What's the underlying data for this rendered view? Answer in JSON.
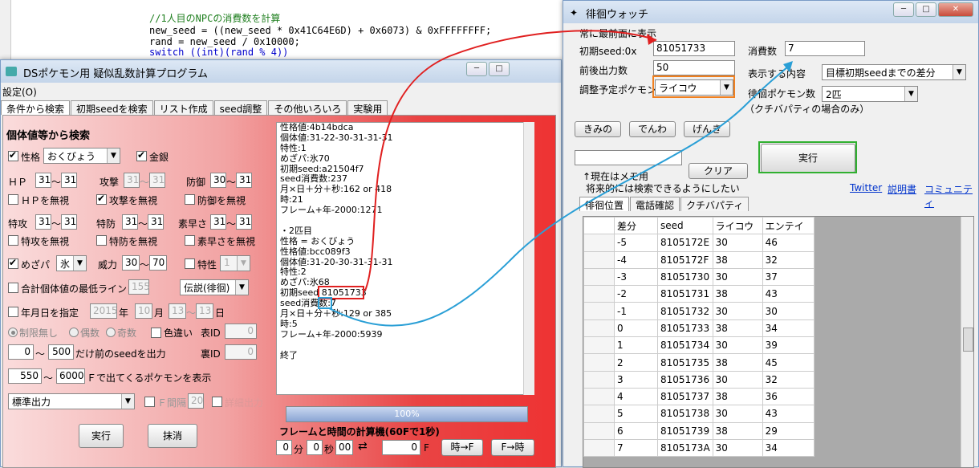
{
  "code": {
    "lines": [
      "//1人目のNPCの消費数を計算",
      "new_seed = ((new_seed * 0x41C64E6D) + 0x6073) & 0xFFFFFFFF;",
      "rand = new_seed / 0x10000;",
      "switch ((int)(rand % 4))"
    ]
  },
  "left_window": {
    "title": "DSポケモン用 疑似乱数計算プログラム",
    "menu": "設定(O)",
    "tabs": [
      "条件から検索",
      "初期seedを検索",
      "リスト作成",
      "seed調整",
      "その他いろいろ",
      "実験用"
    ],
    "section_title": "個体値等から検索",
    "nature_label": "性格",
    "nature_value": "おくびょう",
    "shiny_label": "金銀",
    "hp_label": "ＨＰ",
    "hp_min": "31",
    "hp_max": "31",
    "atk_label": "攻撃",
    "atk_min": "31",
    "atk_max": "31",
    "def_label": "防御",
    "def_min": "30",
    "def_max": "31",
    "ignore_hp": "ＨＰを無視",
    "ignore_atk": "攻撃を無視",
    "ignore_def": "防御を無視",
    "spa_label": "特攻",
    "spa_min": "31",
    "spa_max": "31",
    "spd_label": "特防",
    "spd_min": "31",
    "spd_max": "31",
    "spe_label": "素早さ",
    "spe_min": "31",
    "spe_max": "31",
    "ignore_spa": "特攻を無視",
    "ignore_spd": "特防を無視",
    "ignore_spe": "素早さを無視",
    "hp_type_label": "めざパ",
    "hp_type_value": "氷",
    "power_label": "威力",
    "power_min": "30",
    "power_max": "70",
    "ability_label": "特性",
    "ability_value": "1",
    "min_total_label": "合計個体値の最低ライン",
    "min_total_value": "155",
    "encounter_value": "伝説(徘徊)",
    "date_label": "年月日を指定",
    "year_value": "2015",
    "year_unit": "年",
    "month_value": "10",
    "month_unit": "月",
    "day_min": "13",
    "day_max": "13",
    "day_unit": "日",
    "radio_none": "制限無し",
    "radio_even": "偶数",
    "radio_odd": "奇数",
    "shiny_check": "色違い",
    "tid_label": "表ID",
    "tid_value": "0",
    "sid_label": "裏ID",
    "sid_value": "0",
    "seed_range_min": "0",
    "seed_range_max": "500",
    "seed_range_text": "だけ前のseedを出力",
    "frame_min": "550",
    "frame_max": "6000",
    "frame_text": "Ｆで出てくるポケモンを表示",
    "output_mode": "標準出力",
    "f_interval_label": "Ｆ間隔",
    "f_interval_value": "20",
    "extra_check": "詳細出力",
    "execute_button": "実行",
    "clear_button": "抹消",
    "result_lines": [
      "性格値:4b14bdca",
      "個体値:31-22-30-31-31-31",
      "特性:1",
      "めざパ:氷70",
      "初期seed:a21504f7",
      "seed消費数:237",
      "月×日＋分＋秒:162 or 418",
      "時:21",
      "フレーム+年-2000:1271",
      "",
      "・2匹目",
      "性格 = おくびょう",
      "性格値:bcc089f3",
      "個体値:31-20-30-31-31-31",
      "特性:2",
      "めざパ:氷68",
      "初期seed 81051733",
      "seed消費数:7",
      "月×日＋分＋秒:129 or 385",
      "時:5",
      "フレーム+年-2000:5939",
      "",
      "終了"
    ],
    "progress_text": "100%",
    "calc_title": "フレームと時間の計算機(60Fで1秒)",
    "minute_value": "0",
    "minute_unit": "分",
    "second_value": "0",
    "second_unit": "秒",
    "frame_value2": "00",
    "frame_result": "0",
    "frame_unit": "F",
    "time_to_f_button": "時→F",
    "f_to_time_button": "F→時"
  },
  "right_window": {
    "title": "徘徊ウォッチ",
    "topmost_label": "常に最前面に表示",
    "seed_label": "初期seed:0x",
    "seed_value": "81051733",
    "consume_label": "消費数",
    "consume_value": "7",
    "range_label": "前後出力数",
    "range_value": "50",
    "display_label": "表示する内容",
    "display_value": "目標初期seedまでの差分",
    "pokemon_label": "調整予定ポケモン",
    "pokemon_value": "ライコウ",
    "roamer_count_label": "徘徊ポケモン数",
    "roamer_count_value": "2匹",
    "kuchiba_note": "（クチバパティの場合のみ）",
    "btn_kimino": "きみの",
    "btn_denwa": "でんわ",
    "btn_genki": "げんき",
    "execute_button": "実行",
    "clear_button": "クリア",
    "memo_note1": "↑現在はメモ用",
    "memo_note2": "将来的には検索できるようにしたい",
    "link_twitter": "Twitter",
    "link_manual": "説明書",
    "link_community": "コミュニティ",
    "tabs": [
      "徘徊位置",
      "電話確認",
      "クチバパティ"
    ],
    "table": {
      "headers": [
        "差分",
        "seed",
        "ライコウ",
        "エンテイ"
      ],
      "rows": [
        [
          "-5",
          "8105172E",
          "30",
          "46"
        ],
        [
          "-4",
          "8105172F",
          "38",
          "32"
        ],
        [
          "-3",
          "81051730",
          "30",
          "37"
        ],
        [
          "-2",
          "81051731",
          "38",
          "43"
        ],
        [
          "-1",
          "81051732",
          "30",
          "30"
        ],
        [
          "0",
          "81051733",
          "38",
          "34"
        ],
        [
          "1",
          "81051734",
          "30",
          "39"
        ],
        [
          "2",
          "81051735",
          "38",
          "45"
        ],
        [
          "3",
          "81051736",
          "30",
          "32"
        ],
        [
          "4",
          "81051737",
          "38",
          "36"
        ],
        [
          "5",
          "81051738",
          "30",
          "43"
        ],
        [
          "6",
          "81051739",
          "38",
          "29"
        ],
        [
          "7",
          "8105173A",
          "30",
          "34"
        ]
      ]
    }
  },
  "colors": {
    "red_arrow": "#e02020",
    "blue_arrow": "#2a9fd6",
    "orange_box": "#f08020",
    "green_box": "#30b030",
    "red_box": "#e02020"
  }
}
